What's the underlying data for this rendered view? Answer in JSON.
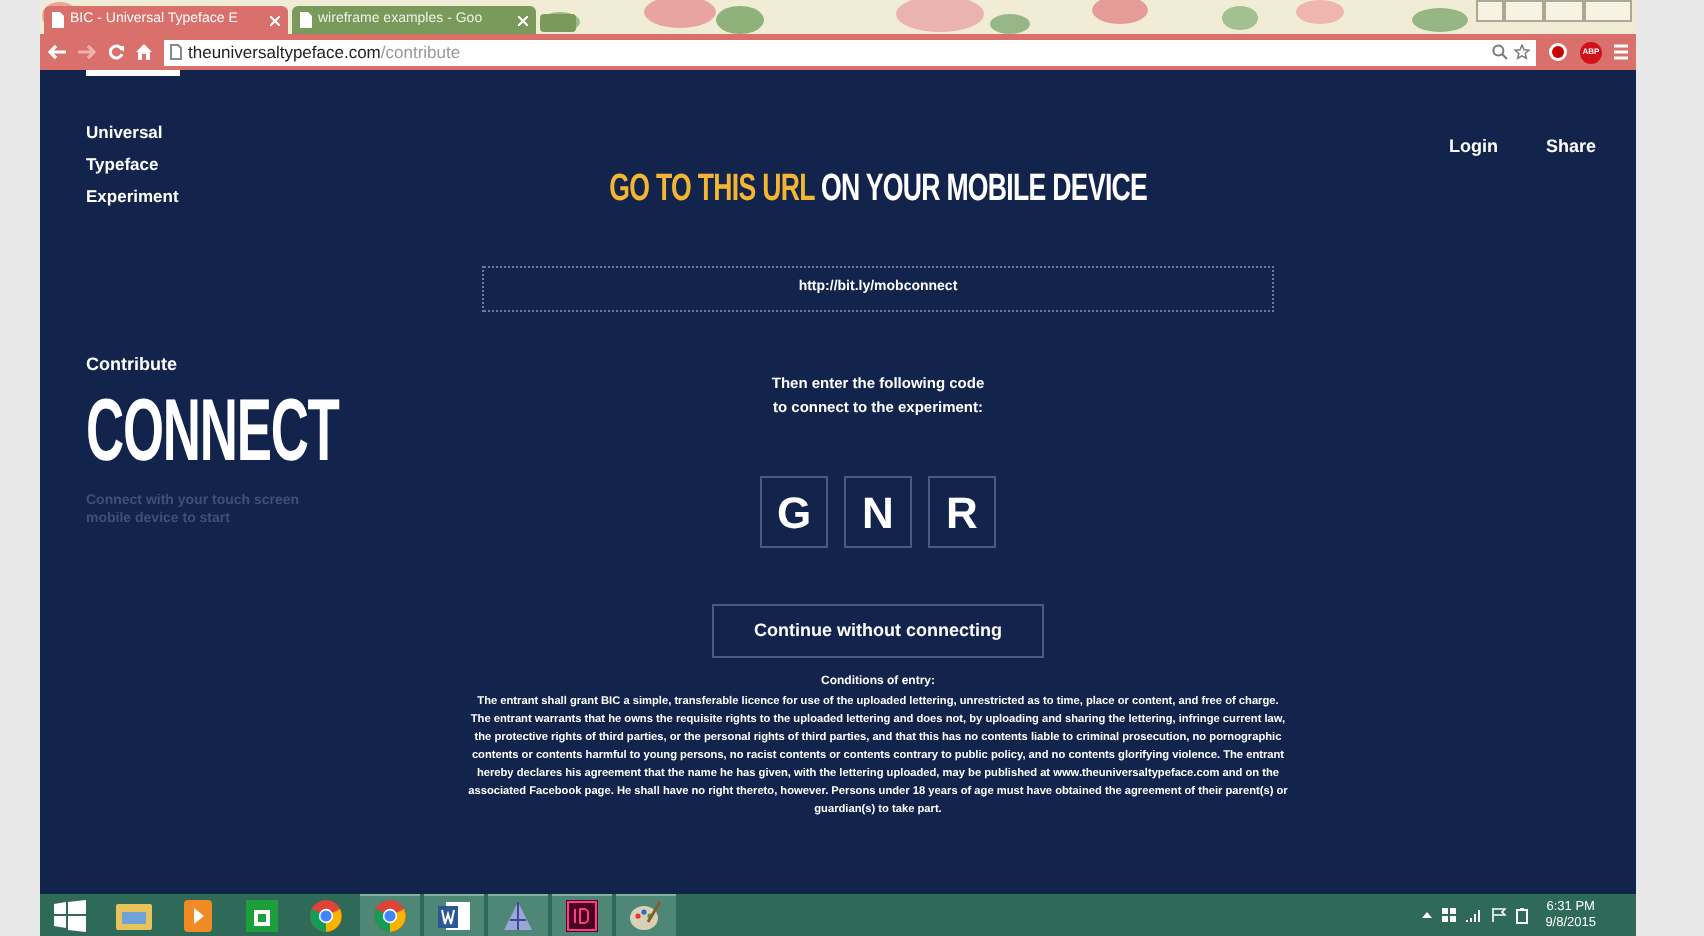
{
  "browser": {
    "tabs": [
      {
        "title": "BIC - Universal Typeface E",
        "selected": true
      },
      {
        "title": "wireframe examples - Goo",
        "selected": false
      }
    ],
    "address": {
      "host": "theuniversaltypeface.com",
      "path": "/contribute"
    },
    "adblock": "ABP"
  },
  "site": {
    "brand": [
      "Universal",
      "Typeface",
      "Experiment"
    ],
    "nav": [
      "Login",
      "Share"
    ]
  },
  "headline": {
    "highlight": "GO TO THIS URL",
    "rest": "ON YOUR MOBILE DEVICE"
  },
  "url_box": "http://bit.ly/mobconnect",
  "section": {
    "label": "Contribute",
    "title": "CONNECT",
    "description": "Connect with your touch screen\nmobile device to start"
  },
  "instruction": "Then enter the following code\nto connect to the experiment:",
  "code": [
    "G",
    "N",
    "R"
  ],
  "continue_button": "Continue without connecting",
  "conditions": {
    "title": "Conditions of entry:",
    "text": "The entrant shall grant BIC a simple, transferable licence for use of the uploaded lettering, unrestricted as to time, place or content, and free of charge. The entrant warrants that he owns the requisite rights to the uploaded lettering and does not, by uploading and sharing the lettering, infringe current law, the protective rights of third parties, or the personal rights of third parties, and that this has no contents liable to criminal prosecution, no pornographic contents or contents harmful to young persons, no racist contents or contents contrary to public policy, and no contents glorifying violence. The entrant hereby declares his agreement that the name he has given, with the lettering uploaded, may be published at www.theuniversaltypeface.com and on the associated Facebook page. He shall have no right thereto, however. Persons under 18 years of age must have obtained the agreement of their parent(s) or guardian(s) to take part."
  },
  "taskbar": {
    "apps": [
      {
        "kind": "start",
        "running": false
      },
      {
        "kind": "files",
        "running": false
      },
      {
        "kind": "media",
        "running": false
      },
      {
        "kind": "store",
        "running": false
      },
      {
        "kind": "chrome",
        "running": false
      },
      {
        "kind": "chrome",
        "running": true
      },
      {
        "kind": "word",
        "running": true
      },
      {
        "kind": "pyramid",
        "running": true
      },
      {
        "kind": "indesign",
        "running": true
      },
      {
        "kind": "paint",
        "running": true
      }
    ],
    "time": "6:31 PM",
    "date": "9/8/2015"
  }
}
